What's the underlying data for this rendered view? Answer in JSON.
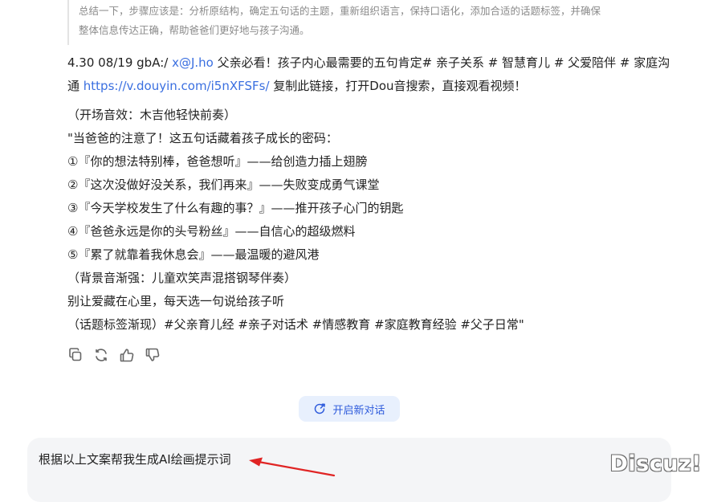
{
  "quote": {
    "line1": "总结一下，步骤应该是：分析原结构，确定五句话的主题，重新组织语言，保持口语化，添加合适的话题标签，并确保",
    "line2": "整体信息传达正确，帮助爸爸们更好地与孩子沟通。"
  },
  "message": {
    "head_prefix": "4.30 08/19 gbA:/ ",
    "head_link1": "x@J.ho",
    "head_mid": " 父亲必看！孩子内心最需要的五句肯定# 亲子关系 # 智慧育儿 # 父爱陪伴 # 家庭沟通 ",
    "head_link2": "https://v.douyin.com/i5nXFSFs/",
    "head_suffix": " 复制此链接，打开Dou音搜索，直接观看视频！",
    "lines": [
      "（开场音效：木吉他轻快前奏）",
      "\"当爸爸的注意了！这五句话藏着孩子成长的密码：",
      "①『你的想法特别棒，爸爸想听』——给创造力插上翅膀",
      "②『这次没做好没关系，我们再来』——失败变成勇气课堂",
      "③『今天学校发生了什么有趣的事？』——推开孩子心门的钥匙",
      "④『爸爸永远是你的头号粉丝』——自信心的超级燃料",
      "⑤『累了就靠着我休息会』——最温暖的避风港",
      "（背景音渐强：儿童欢笑声混搭钢琴伴奏）",
      "别让爱藏在心里，每天选一句说给孩子听",
      "（话题标签渐现）#父亲育儿经 #亲子对话术 #情感教育 #家庭教育经验 #父子日常\""
    ]
  },
  "actions": {
    "icons": [
      "copy-icon",
      "regenerate-icon",
      "thumbs-up-icon",
      "thumbs-down-icon"
    ]
  },
  "new_chat": {
    "label": "开启新对话",
    "icon": "new-chat-icon"
  },
  "input": {
    "value": "根据以上文案帮我生成AI绘画提示词"
  },
  "annotation": {
    "color": "#e02424"
  },
  "watermark": {
    "text": "Discuz!"
  },
  "colors": {
    "link": "#3a6fe0",
    "accent": "#2e5bdc",
    "new_chat_bg": "#e8f0fd"
  }
}
